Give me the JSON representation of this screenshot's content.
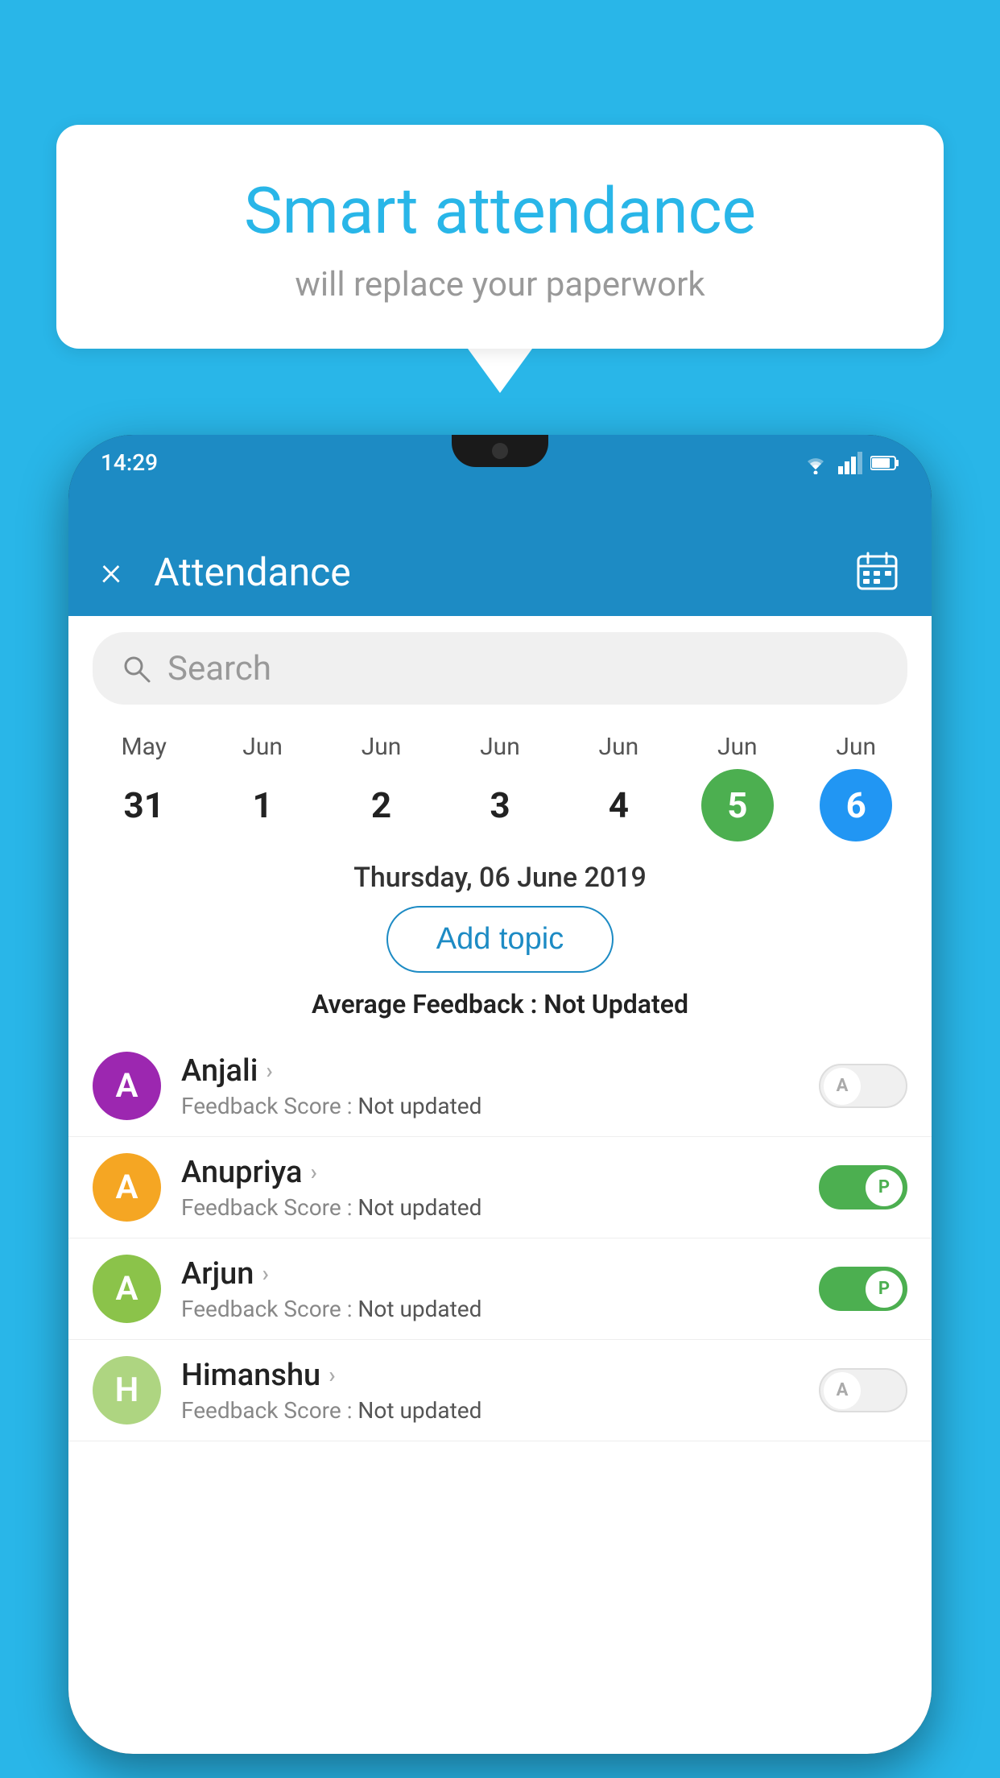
{
  "background_color": "#29b6e8",
  "speech_bubble": {
    "title": "Smart attendance",
    "subtitle": "will replace your paperwork"
  },
  "status_bar": {
    "time": "14:29"
  },
  "header": {
    "title": "Attendance",
    "close_label": "×",
    "calendar_icon": "calendar-icon"
  },
  "search": {
    "placeholder": "Search"
  },
  "calendar": {
    "days": [
      {
        "month": "May",
        "date": "31",
        "state": "normal"
      },
      {
        "month": "Jun",
        "date": "1",
        "state": "normal"
      },
      {
        "month": "Jun",
        "date": "2",
        "state": "normal"
      },
      {
        "month": "Jun",
        "date": "3",
        "state": "normal"
      },
      {
        "month": "Jun",
        "date": "4",
        "state": "normal"
      },
      {
        "month": "Jun",
        "date": "5",
        "state": "today"
      },
      {
        "month": "Jun",
        "date": "6",
        "state": "selected"
      }
    ]
  },
  "selected_date": "Thursday, 06 June 2019",
  "add_topic_label": "Add topic",
  "avg_feedback_label": "Average Feedback :",
  "avg_feedback_value": "Not Updated",
  "students": [
    {
      "name": "Anjali",
      "initial": "A",
      "avatar_color": "#9c27b0",
      "feedback_label": "Feedback Score :",
      "feedback_value": "Not updated",
      "toggle_state": "off",
      "toggle_label": "A"
    },
    {
      "name": "Anupriya",
      "initial": "A",
      "avatar_color": "#f5a623",
      "feedback_label": "Feedback Score :",
      "feedback_value": "Not updated",
      "toggle_state": "on",
      "toggle_label": "P"
    },
    {
      "name": "Arjun",
      "initial": "A",
      "avatar_color": "#8bc34a",
      "feedback_label": "Feedback Score :",
      "feedback_value": "Not updated",
      "toggle_state": "on",
      "toggle_label": "P"
    },
    {
      "name": "Himanshu",
      "initial": "H",
      "avatar_color": "#aed581",
      "feedback_label": "Feedback Score :",
      "feedback_value": "Not updated",
      "toggle_state": "off",
      "toggle_label": "A"
    }
  ]
}
